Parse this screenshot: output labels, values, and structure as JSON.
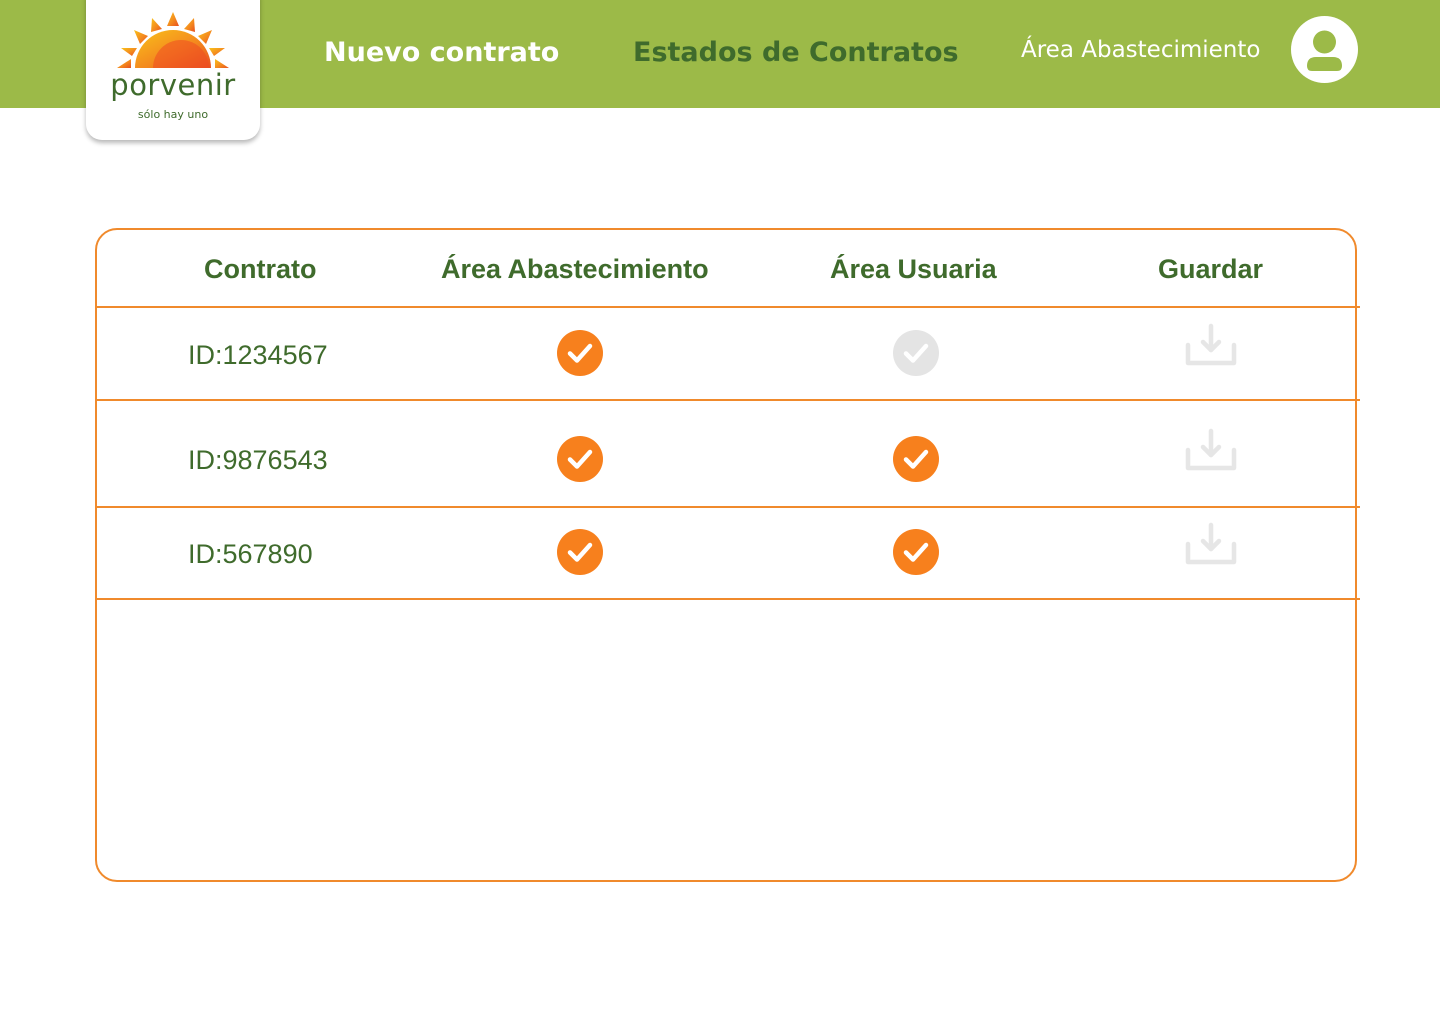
{
  "header": {
    "brand": {
      "name": "porvenir",
      "tagline": "sólo hay uno"
    },
    "nav": {
      "new_contract": "Nuevo contrato",
      "contract_states": "Estados de Contratos"
    },
    "user_area": "Área Abastecimiento"
  },
  "table": {
    "columns": [
      "Contrato",
      "Área Abastecimiento",
      "Área Usuaria",
      "Guardar"
    ],
    "rows": [
      {
        "contract": "ID:1234567",
        "area_abastecimiento": "approved",
        "area_usuaria": "pending",
        "guardar": "disabled"
      },
      {
        "contract": "ID:9876543",
        "area_abastecimiento": "approved",
        "area_usuaria": "approved",
        "guardar": "disabled"
      },
      {
        "contract": "ID:567890",
        "area_abastecimiento": "approved",
        "area_usuaria": "approved",
        "guardar": "disabled"
      }
    ]
  },
  "colors": {
    "header_bg": "#9cba48",
    "brand_green": "#3f6b2c",
    "accent_orange": "#f7801d",
    "border_orange": "#f08a2c",
    "disabled_gray": "#e4e4e4"
  },
  "icons": {
    "approved": "check-circle-icon",
    "pending": "check-circle-icon",
    "save": "download-icon",
    "user": "user-avatar-icon"
  }
}
